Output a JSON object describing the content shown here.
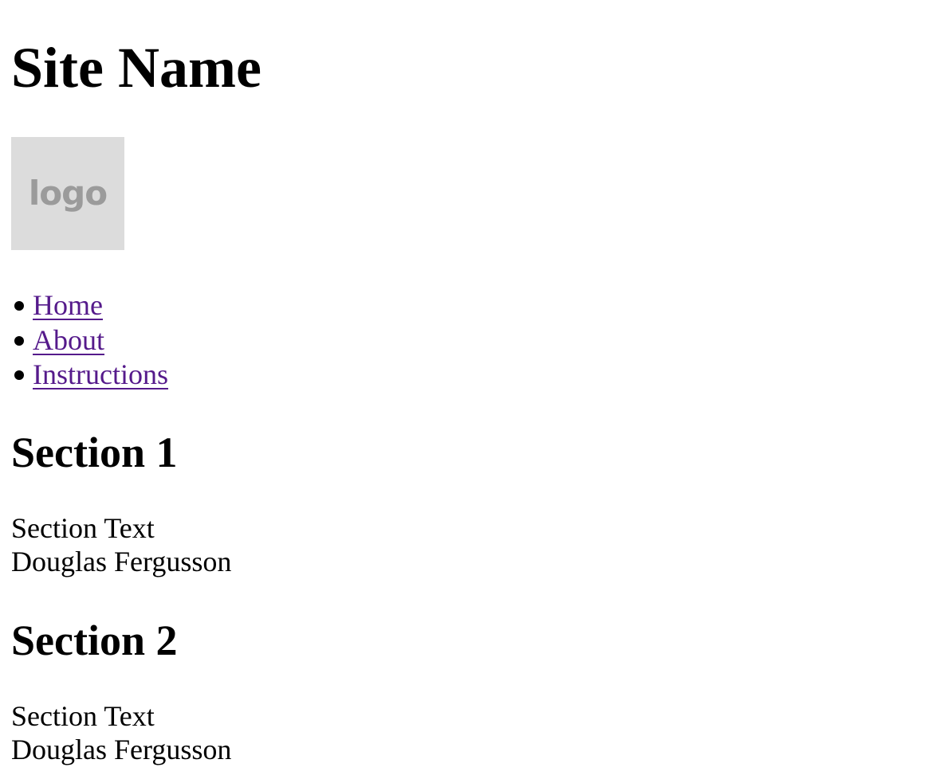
{
  "site": {
    "title": "Site Name",
    "logo_text": "logo"
  },
  "nav": {
    "items": [
      {
        "label": "Home",
        "color": "#551a8b"
      },
      {
        "label": "About",
        "color": "#551a8b"
      },
      {
        "label": "Instructions",
        "color": "#551a8b"
      }
    ]
  },
  "sections": [
    {
      "heading": "Section 1",
      "text": "Section Text",
      "author": "Douglas Fergusson"
    },
    {
      "heading": "Section 2",
      "text": "Section Text",
      "author": "Douglas Fergusson"
    }
  ]
}
